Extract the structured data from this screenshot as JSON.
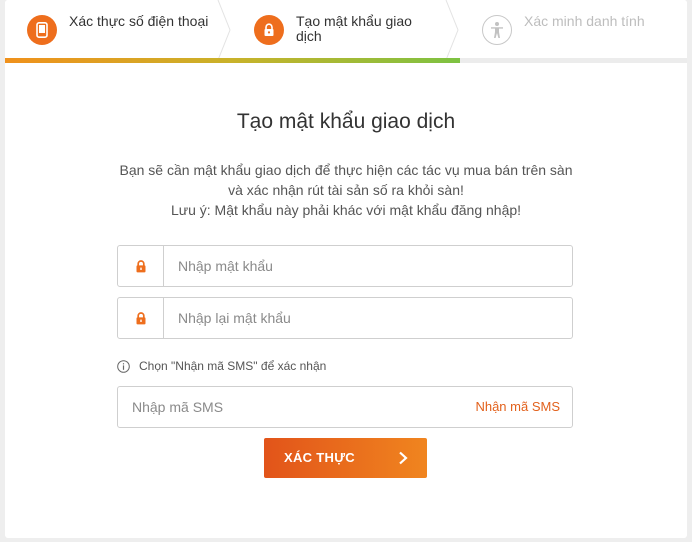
{
  "stepper": {
    "steps": [
      {
        "label": "Xác thực số điện thoại",
        "icon": "phone-icon",
        "state": "done"
      },
      {
        "label": "Tạo mật khẩu giao dịch",
        "icon": "lock-icon",
        "state": "current"
      },
      {
        "label": "Xác minh danh tính",
        "icon": "person-icon",
        "state": "pending"
      }
    ],
    "progress_fraction": 0.667
  },
  "main": {
    "title": "Tạo mật khẩu giao dịch",
    "description_lines": [
      "Bạn sẽ cần mật khẩu giao dịch để thực hiện các tác vụ mua bán trên sàn",
      "và xác nhận rút tài sản số ra khỏi sàn!",
      "Lưu ý: Mật khẩu này phải khác với mật khẩu đăng nhập!"
    ]
  },
  "form": {
    "password_placeholder": "Nhập mật khẩu",
    "confirm_placeholder": "Nhập lại mật khẩu",
    "hint_text": "Chọn \"Nhận mã SMS\" để xác nhận",
    "sms_placeholder": "Nhập mã SMS",
    "sms_link_label": "Nhận mã SMS",
    "submit_label": "XÁC THỰC"
  },
  "colors": {
    "accent": "#ee6e1d",
    "progress_start": "#f0911c",
    "progress_end": "#7dc242",
    "inactive_text": "#bdbdbd"
  }
}
